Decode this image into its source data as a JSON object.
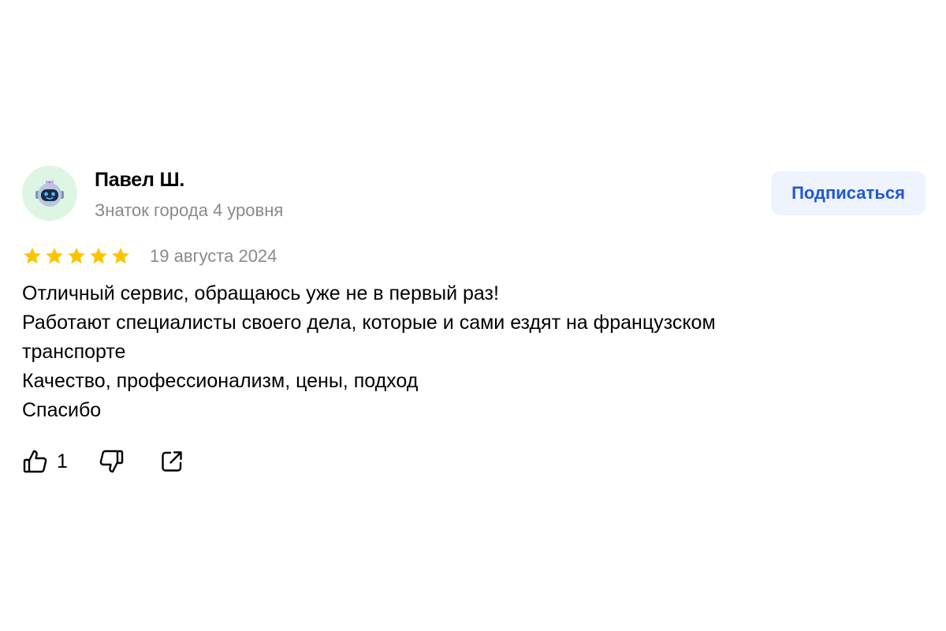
{
  "review": {
    "author": {
      "name": "Павел Ш.",
      "level": "Знаток города 4 уровня",
      "avatar_icon": "robot-avatar-icon"
    },
    "subscribe_label": "Подписаться",
    "rating": 5,
    "rating_max": 5,
    "date": "19 августа 2024",
    "text_lines": [
      "Отличный сервис, обращаюсь уже не в первый раз!",
      "Работают специалисты своего дела, которые и сами ездят на французском",
      "транспорте",
      "Качество, профессионализм, цены, подход",
      "Спасибо"
    ],
    "actions": {
      "like_icon": "thumbs-up-icon",
      "like_count": "1",
      "dislike_icon": "thumbs-down-icon",
      "share_icon": "share-icon"
    }
  },
  "colors": {
    "star": "#fcc400",
    "accent": "#1f57d6",
    "button_bg": "#eef3fd",
    "muted_text": "#8a8a8a",
    "avatar_bg": "#dff5e3"
  }
}
